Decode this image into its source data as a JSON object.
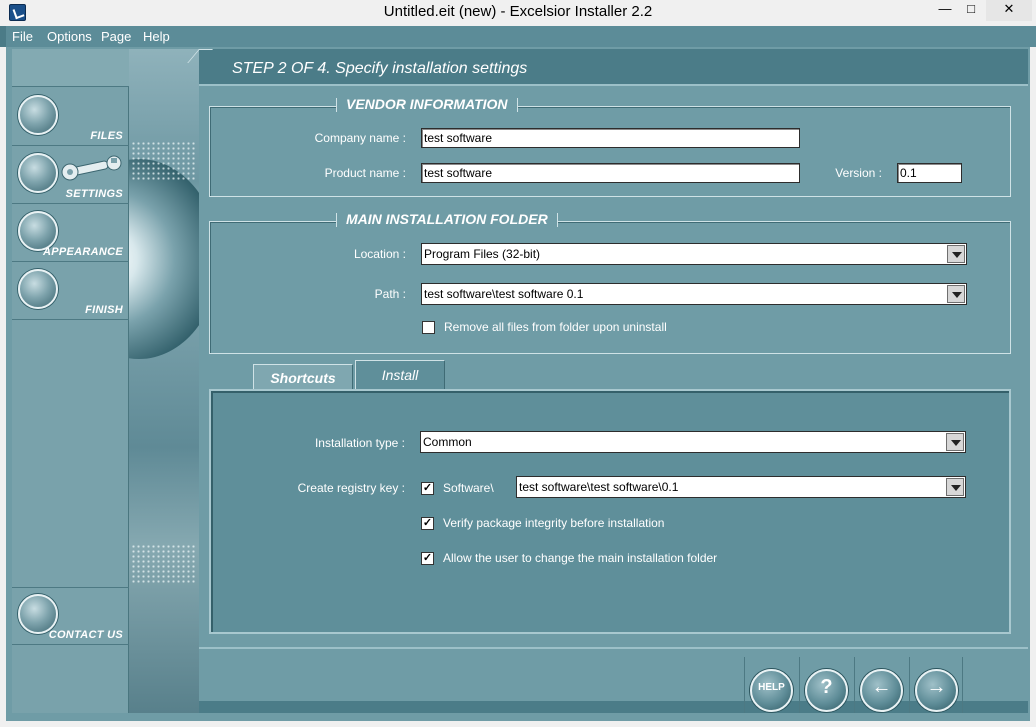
{
  "window": {
    "title": "Untitled.eit (new) - Excelsior Installer 2.2",
    "controls": {
      "minimize": "—",
      "maximize": "□",
      "close": "✕"
    }
  },
  "menu": {
    "items": [
      "File",
      "Options",
      "Page",
      "Help"
    ]
  },
  "sidebar": {
    "items": [
      {
        "label": "FILES"
      },
      {
        "label": "SETTINGS"
      },
      {
        "label": "APPEARANCE"
      },
      {
        "label": "FINISH"
      }
    ],
    "contact_label": "CONTACT US"
  },
  "step": {
    "title": "STEP 2 OF 4. Specify installation settings"
  },
  "vendor": {
    "title": "VENDOR INFORMATION",
    "company_label": "Company name :",
    "company_value": "test software",
    "product_label": "Product name :",
    "product_value": "test software",
    "version_label": "Version :",
    "version_value": "0.1"
  },
  "folder": {
    "title": "MAIN INSTALLATION FOLDER",
    "location_label": "Location :",
    "location_value": "Program Files (32-bit)",
    "path_label": "Path :",
    "path_value": "test software\\test software 0.1",
    "remove_label": "Remove all files from folder upon uninstall",
    "remove_checked": false
  },
  "tabs": {
    "shortcuts": "Shortcuts",
    "install": "Install"
  },
  "install": {
    "type_label": "Installation type :",
    "type_value": "Common",
    "registry_label": "Create registry key :",
    "registry_prefix": "Software\\",
    "registry_value": "test software\\test software\\0.1",
    "verify_label": "Verify package integrity before installation",
    "allow_label": "Allow the user to change the main installation folder",
    "check_mark": "✓"
  },
  "bottom": {
    "help_label": "HELP",
    "whats_this_glyph": "?",
    "back_glyph": "←",
    "next_glyph": "→"
  }
}
